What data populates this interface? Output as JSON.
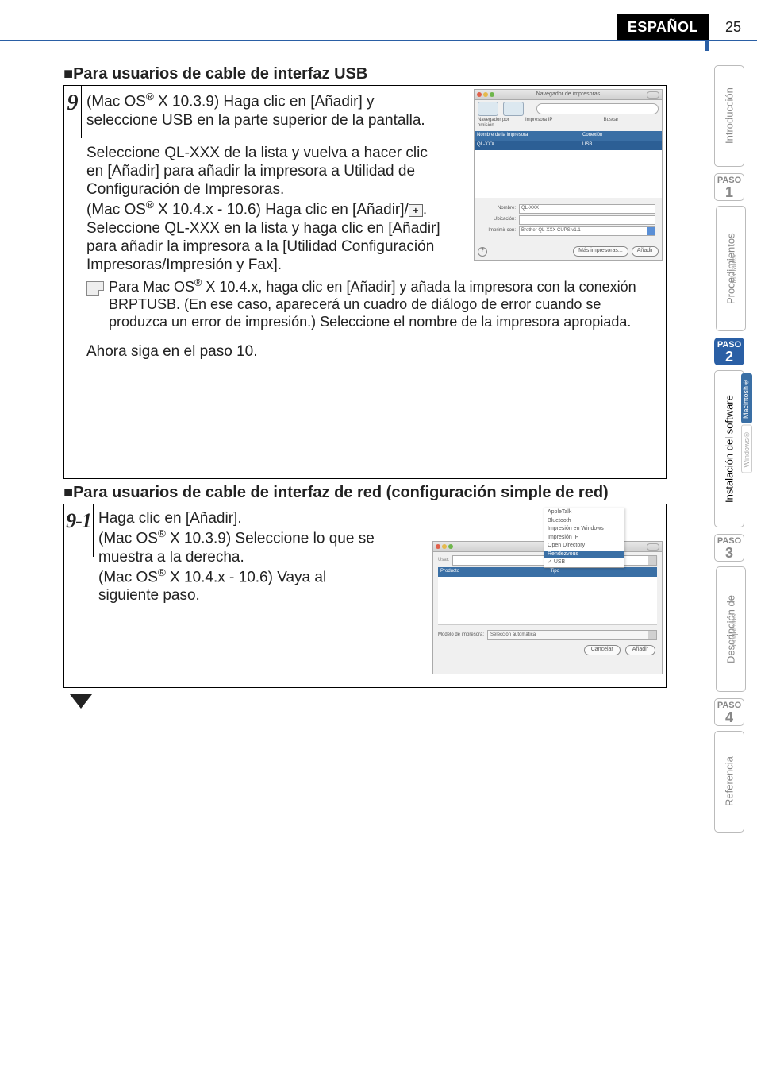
{
  "header": {
    "language": "ESPAÑOL",
    "page_number": "25"
  },
  "sidebar": {
    "tabs": {
      "intro": "Introducción",
      "proc_main": "Procedimientos",
      "proc_sub": "iniciales",
      "inst_main": "Instalación del software",
      "inst_sub_mac": "Macintosh®",
      "inst_sub_win": "Windows®",
      "desc_main": "Descripción de",
      "desc_sub": "etiquetas",
      "ref": "Referencia"
    },
    "paso": {
      "label": "PASO",
      "n1": "1",
      "n2": "2",
      "n3": "3",
      "n4": "4"
    }
  },
  "sections": {
    "usb_title": "■Para usuarios de cable de interfaz USB",
    "net_title": "■Para usuarios de cable de interfaz de red (configuración simple de red)"
  },
  "step9": {
    "num": "9",
    "p1a": "(Mac OS",
    "p1b": " X 10.3.9) Haga clic en [Añadir] y seleccione USB en la parte superior de la pantalla.",
    "p2": "Seleccione QL-XXX de la lista y vuelva a hacer clic en [Añadir] para añadir la impresora a Utilidad de Configuración de Impresoras.",
    "p3a": "(Mac OS",
    "p3b": " X 10.4.x - 10.6) Haga clic en [Añadir]/",
    "p3c": ". Seleccione QL-XXX en la lista y haga clic en [Añadir] para añadir la impresora a la [Utilidad Configuración Impresoras/Impresión y Fax].",
    "note_a": "Para Mac OS",
    "note_b": " X 10.4.x, haga clic en [Añadir] y añada la impresora con la conexión BRPTUSB. (En ese caso, aparecerá un cuadro de diálogo de error cuando se produzca un error de impresión.) Seleccione el nombre de la impresora apropiada.",
    "p4": "Ahora siga en el paso 10.",
    "plus": "+",
    "reg": "®"
  },
  "step91": {
    "num": "9-1",
    "p1": "Haga clic en [Añadir].",
    "p2a": "(Mac OS",
    "p2b": " X 10.3.9) Seleccione lo que se muestra a la derecha.",
    "p3a": "(Mac OS",
    "p3b": " X 10.4.x - 10.6) Vaya al siguiente paso.",
    "reg": "®"
  },
  "shot1": {
    "title": "Navegador de impresoras",
    "tb1": "Navegador por omisión",
    "tb2": "Impresora IP",
    "tb3": "Buscar",
    "col1": "Nombre de la impresora",
    "col2": "Conexión",
    "row_name": "QL-XXX",
    "row_conn": "USB",
    "lbl_nombre": "Nombre:",
    "val_nombre": "QL-XXX",
    "lbl_ubic": "Ubicación:",
    "lbl_impr": "Imprimir con:",
    "val_impr": "Brother QL-XXX   CUPS v1.1",
    "btn_mas": "Más impresoras...",
    "btn_anadir": "Añadir",
    "help": "?"
  },
  "shot2": {
    "menu": {
      "appletalk": "AppleTalk",
      "bluetooth": "Bluetooth",
      "winprint": "Impresión en Windows",
      "ipprint": "Impresión IP",
      "opendir": "Open Directory",
      "rendezvous": "Rendezvous",
      "usb": "USB"
    },
    "label_usar": "Usar:",
    "col_producto": "Producto",
    "col_tipo": "Tipo",
    "label_modelo": "Modelo de impresora:",
    "val_modelo": "Selección automática",
    "btn_cancel": "Cancelar",
    "btn_anadir": "Añadir"
  }
}
